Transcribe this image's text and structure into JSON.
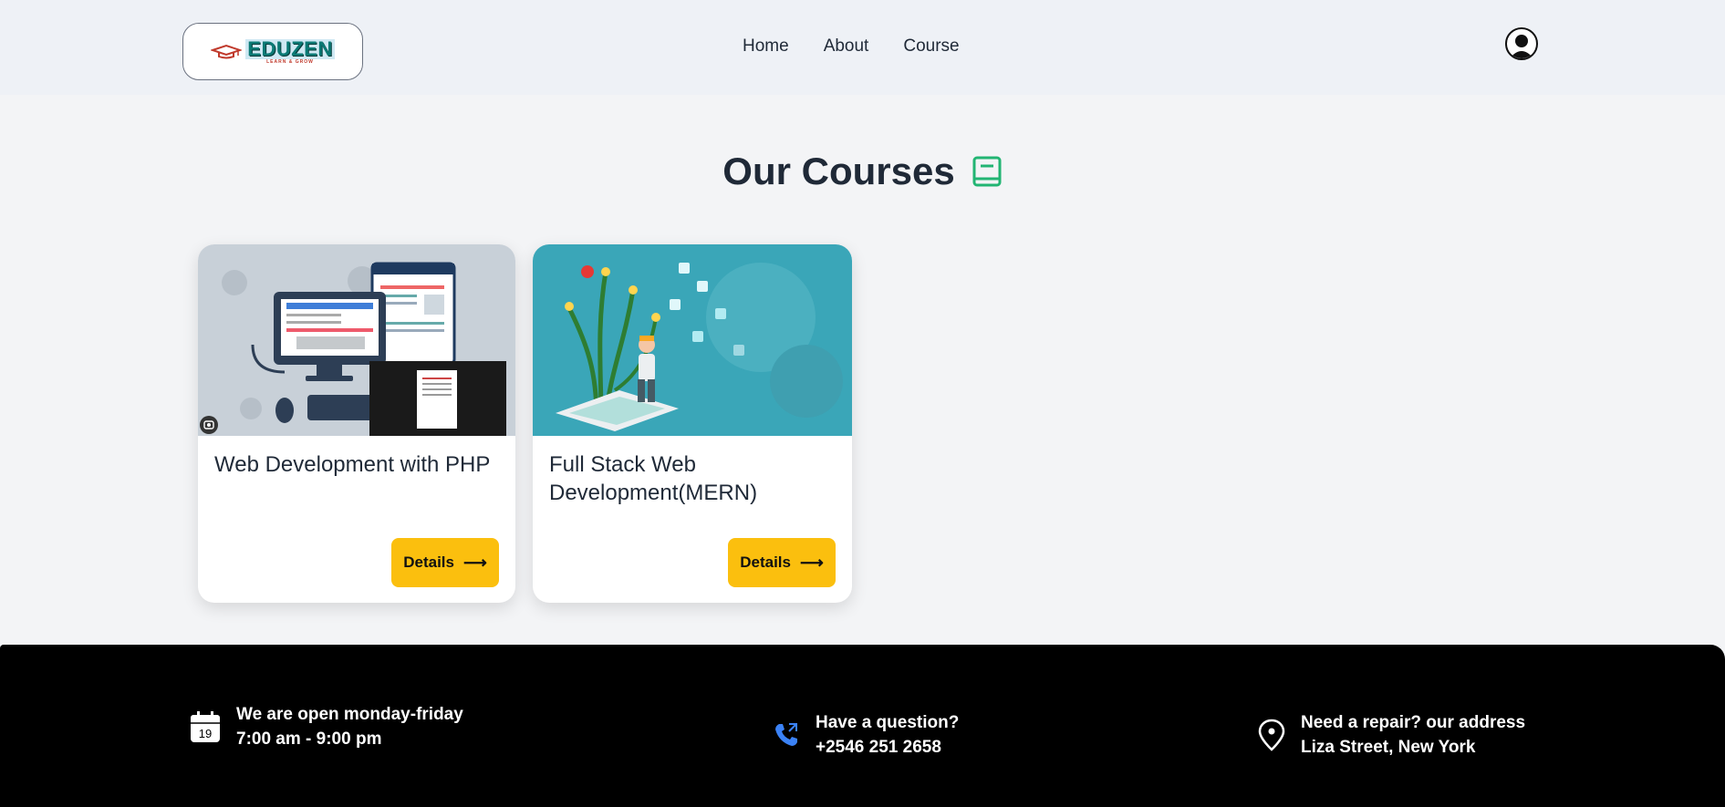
{
  "header": {
    "logo_text": "EDUZEN",
    "logo_tagline": "LEARN & GROW",
    "nav": [
      {
        "label": "Home"
      },
      {
        "label": "About"
      },
      {
        "label": "Course"
      }
    ]
  },
  "main": {
    "title": "Our Courses",
    "courses": [
      {
        "title": "Web Development with PHP",
        "button": "Details"
      },
      {
        "title": "Full Stack Web Development(MERN)",
        "button": "Details"
      }
    ]
  },
  "footer": {
    "hours": {
      "title": "We are open monday-friday",
      "value": "7:00 am - 9:00 pm",
      "calendar_day": "19"
    },
    "phone": {
      "title": "Have a question?",
      "value": "+2546 251 2658"
    },
    "address": {
      "title": "Need a repair? our address",
      "value": "Liza Street, New York"
    }
  },
  "colors": {
    "accent": "#fbbf0e",
    "book_icon": "#22b573",
    "phone_icon": "#3b82f6",
    "footer_bg": "#000000"
  },
  "icons": [
    "book-icon",
    "user-avatar-icon",
    "calendar-icon",
    "phone-icon",
    "location-pin-icon",
    "arrow-right-icon",
    "image-overlay-icon"
  ]
}
